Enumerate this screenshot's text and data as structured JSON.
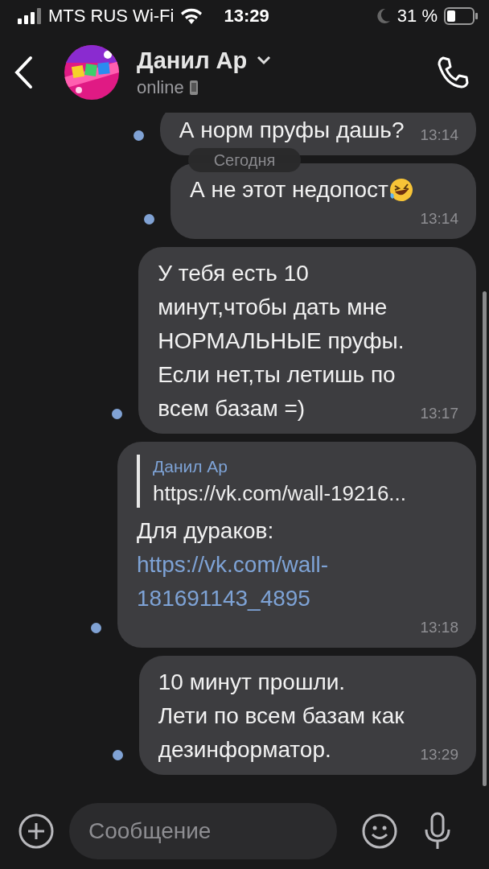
{
  "status_bar": {
    "carrier": "MTS RUS Wi-Fi",
    "time": "13:29",
    "battery": "31 %"
  },
  "header": {
    "name": "Данил Ар",
    "status": "online"
  },
  "date_divider": "Сегодня",
  "messages": [
    {
      "kind": "text",
      "text": "А норм пруфы дашь?",
      "time": "13:14",
      "unread": true
    },
    {
      "kind": "emoji",
      "text": "А не этот недопост",
      "time": "13:14",
      "unread": true
    },
    {
      "kind": "text",
      "text": "У тебя есть 10\nминут,чтобы дать мне\nНОРМАЛЬНЫЕ пруфы.\nЕсли нет,ты летишь по\nвсем базам =)",
      "time": "13:17",
      "unread": true
    },
    {
      "kind": "forward",
      "quote_author": "Данил Ар",
      "quote_text": "https://vk.com/wall-19216...",
      "text": "Для дураков:",
      "link": "https://vk.com/wall-181691143_4895",
      "time": "13:18",
      "unread": true
    },
    {
      "kind": "text",
      "text": "10 минут прошли.\nЛети по всем базам как\nдезинформатор.",
      "time": "13:29",
      "unread": true
    }
  ],
  "composer": {
    "placeholder": "Сообщение"
  }
}
